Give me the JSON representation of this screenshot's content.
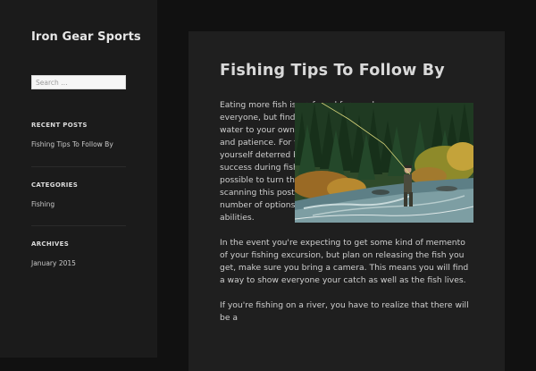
{
  "site": {
    "title": "Iron Gear Sports"
  },
  "search": {
    "placeholder": "Search …"
  },
  "widgets": {
    "recent_posts": {
      "title": "RECENT POSTS",
      "items": [
        "Fishing Tips To Follow By"
      ]
    },
    "categories": {
      "title": "CATEGORIES",
      "items": [
        "Fishing"
      ]
    },
    "archives": {
      "title": "ARCHIVES",
      "items": [
        "January 2015"
      ]
    }
  },
  "post": {
    "title": "Fishing Tips To Follow By",
    "image_icon": "fly-fishing-river-photo",
    "paragraphs": [
      "Eating more fish is preferred for nearly everyone, but finding the fish in the water to your own table calls for ability and patience. For those who have found yourself deterred by your dearth of success during fishing excursions, it is possible to turn things around by scanning this post. You'll discover a number of options to enhance your abilities.",
      "In the event you're expecting to get some kind of memento of your fishing excursion, but plan on releasing the fish you get, make sure you bring a camera. This means you will find a way to show everyone your catch as well as the fish lives.",
      "If you're fishing on a river, you have to realize that there will be a"
    ]
  },
  "colors": {
    "sidebar_bg": "#1b1b1b",
    "page_bg": "#111111",
    "article_bg": "#1f1f1f",
    "text": "#cfcfcf"
  }
}
